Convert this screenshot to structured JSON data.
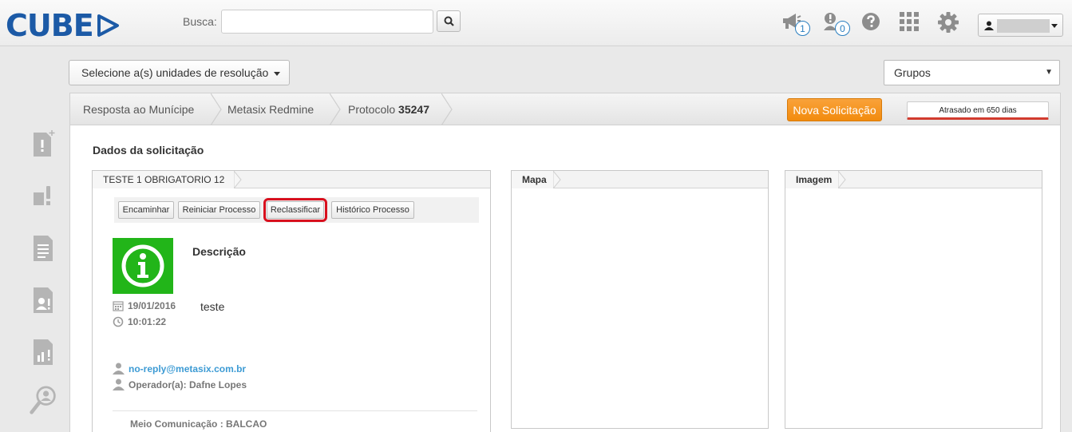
{
  "header": {
    "logo_text": "CUBE",
    "search_label": "Busca:",
    "search_value": "",
    "notifications_count": "1",
    "alerts_count": "0",
    "user_name": ""
  },
  "toolbar": {
    "unit_selector_label": "Selecione a(s) unidades de resolução",
    "groups_selector_label": "Grupos"
  },
  "breadcrumb": {
    "items": [
      "Resposta ao Munícipe",
      "Metasix Redmine"
    ],
    "protocol_label": "Protocolo",
    "protocol_number": "35247"
  },
  "actions": {
    "new_request": "Nova Solicitação",
    "late_status": "Atrasado em 650 dias"
  },
  "request": {
    "section_title": "Dados da solicitação",
    "tab_title": "TESTE 1 OBRIGATORIO 12",
    "buttons": [
      "Encaminhar",
      "Reiniciar Processo",
      "Reclassificar",
      "Histórico Processo"
    ],
    "description_label": "Descrição",
    "description_text": "teste",
    "date": "19/01/2016",
    "time": "10:01:22",
    "email": "no-reply@metasix.com.br",
    "operator": "Operador(a): Dafne Lopes",
    "channel": "Meio Comunicação : BALCAO"
  },
  "panels": {
    "map_title": "Mapa",
    "image_title": "Imagem"
  },
  "colors": {
    "brand_blue": "#1c5aa6",
    "accent_orange": "#f28b0d",
    "late_red": "#d23b2e",
    "info_green": "#22b519",
    "highlight_red": "#d8101e"
  }
}
